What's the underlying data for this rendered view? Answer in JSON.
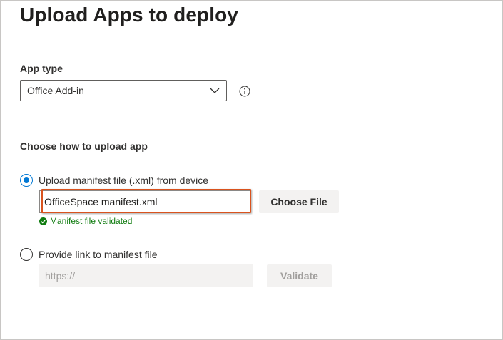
{
  "page": {
    "title": "Upload Apps to deploy"
  },
  "app_type": {
    "label": "App type",
    "selected": "Office Add-in",
    "icon": "chevron-down-icon",
    "info_icon": "info-icon"
  },
  "upload": {
    "heading": "Choose how to upload app",
    "option_file": {
      "label": "Upload manifest file (.xml) from device",
      "selected": true,
      "file_name": "OfficeSpace manifest.xml",
      "choose_button": "Choose File",
      "status": "Manifest file validated",
      "status_color": "#107c10"
    },
    "option_link": {
      "label": "Provide link to manifest file",
      "selected": false,
      "url_placeholder": "https://",
      "validate_button": "Validate"
    }
  },
  "colors": {
    "accent": "#0078d4",
    "highlight": "#d9531e",
    "success": "#107c10"
  }
}
